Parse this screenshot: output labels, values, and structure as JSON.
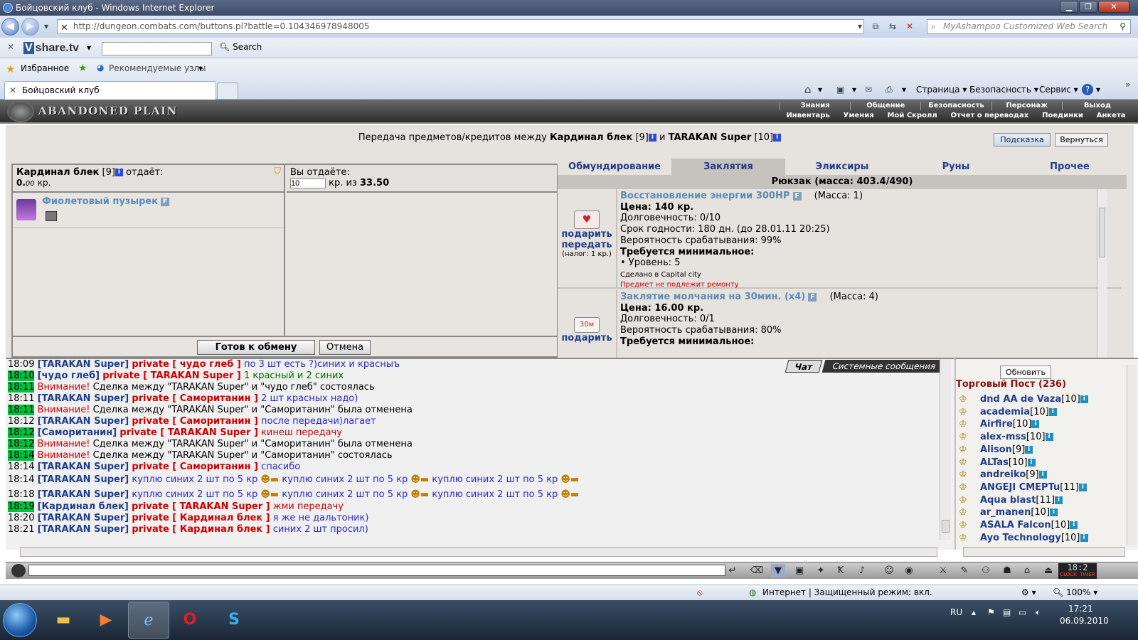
{
  "window": {
    "title": "Бойцовский клуб - Windows Internet Explorer",
    "url": "http://dungeon.combats.com/buttons.pl?battle=0.104346978948005",
    "search_placeholder": "MyAshampoo Customized Web Search"
  },
  "toolbar2": {
    "logo_box": "V",
    "logo": "share.tv",
    "search_label": "Search"
  },
  "favbar": {
    "favorites": "Избранное",
    "suggested": "Рекомендуемые узлы"
  },
  "tab": {
    "title": "Бойцовский клуб"
  },
  "commandbar": {
    "page": "Страница",
    "safety": "Безопасность",
    "tools": "Сервис"
  },
  "game": {
    "logo": "ABANDONED PLAIN",
    "menu_top": [
      "Знания",
      "Общение",
      "Безопасность",
      "Персонаж",
      "Выход"
    ],
    "menu_bottom": [
      "Инвентарь",
      "Умения",
      "Мой Скролл",
      "Отчет о переводах",
      "Поединки",
      "Анкета"
    ]
  },
  "trade": {
    "header_prefix": "Передача предметов/кредитов между",
    "user1": "Кардинал блек",
    "user1_level": "[9]",
    "and": "и",
    "user2": "TARAKAN Super",
    "user2_level": "[10]",
    "hint_btn": "Подсказка",
    "back_btn": "Вернуться",
    "left_title_name": "Кардинал блек",
    "left_title_level": "[9]",
    "left_title_suffix": "отдаёт:",
    "left_amount": "0.",
    "left_amount_dec": "00",
    "left_amount_unit": "кр.",
    "right_title": "Вы отдаёте:",
    "right_input": "10",
    "right_kr": "кр. из",
    "right_total": "33.50",
    "item_name": "Фиолетовый пузырек",
    "ready_btn": "Готов к обмену",
    "cancel_btn": "Отмена"
  },
  "inventory": {
    "tabs": [
      "Обмундирование",
      "Заклятия",
      "Эликсиры",
      "Руны",
      "Прочее"
    ],
    "selected_tab": "Заклятия",
    "bag": "Рюкзак (масса: 403.4/490)",
    "item1": {
      "name": "Восстановление энергии 300HP",
      "mass": "(Масса: 1)",
      "price": "Цена: 140 кр.",
      "durability": "Долговечность: 0/10",
      "expiry": "Срок годности: 180 дн. (до 28.01.11 20:25)",
      "chance": "Вероятность срабатывания: 99%",
      "req": "Требуется минимальное:",
      "level": "• Уровень: 5",
      "made": "Сделано в Capital city",
      "norepair": "Предмет не подлежит ремонту",
      "gift": "подарить",
      "give": "передать",
      "tax": "(налог: 1 кр.)"
    },
    "item2": {
      "name": "Заклятие молчания на 30мин. (x4)",
      "mass": "(Масса: 4)",
      "price": "Цена: 16.00 кр.",
      "durability": "Долговечность: 0/1",
      "chance": "Вероятность срабатывания: 80%",
      "req": "Требуется минимальное:",
      "gift": "подарить"
    }
  },
  "chat": {
    "tabs": [
      "Чат",
      "Системные сообщения"
    ],
    "lines": [
      {
        "t": "18:09",
        "hl": false,
        "a": "[TARAKAN Super]",
        "p": "private [ чудо глеб ]",
        "m": "по 3 шт есть ?)синих и красныъ"
      },
      {
        "t": "18:10",
        "hl": true,
        "a": "[чудо глеб]",
        "p": "private [ TARAKAN Super ]",
        "m": "1 красный и 2 синих"
      },
      {
        "t": "18:11",
        "hl": true,
        "w": "Внимание!",
        "m": "Сделка между \"TARAKAN Super\" и \"чудо глеб\" состоялась"
      },
      {
        "t": "18:11",
        "hl": false,
        "a": "[TARAKAN Super]",
        "p": "private [ Самоританин ]",
        "m": "2 шт красных надо)"
      },
      {
        "t": "18:11",
        "hl": true,
        "w": "Внимание!",
        "m": "Сделка между \"TARAKAN Super\" и \"Самоританин\" была отменена"
      },
      {
        "t": "18:12",
        "hl": false,
        "a": "[TARAKAN Super]",
        "p": "private [ Самоританин ]",
        "m": "после передачи)лагает"
      },
      {
        "t": "18:12",
        "hl": true,
        "a": "[Самоританин]",
        "p": "private [ TARAKAN Super ]",
        "m": "кинеш передачу"
      },
      {
        "t": "18:12",
        "hl": true,
        "w": "Внимание!",
        "m": "Сделка между \"TARAKAN Super\" и \"Самоританин\" была отменена"
      },
      {
        "t": "18:14",
        "hl": true,
        "w": "Внимание!",
        "m": "Сделка между \"TARAKAN Super\" и \"Самоританин\" состоялась"
      },
      {
        "t": "18:14",
        "hl": false,
        "a": "[TARAKAN Super]",
        "p": "private [ Самоританин ]",
        "m": "спасибо"
      },
      {
        "t": "18:14",
        "hl": false,
        "a": "[TARAKAN Super]",
        "m": "куплю синих 2 шт по 5 кр"
      },
      {
        "t": "18:18",
        "hl": false,
        "a": "[TARAKAN Super]",
        "m": "куплю синих 2 шт по 5 кр"
      },
      {
        "t": "18:19",
        "hl": true,
        "a": "[Кардинал блек]",
        "p": "private [ TARAKAN Super ]",
        "m": "жми передачу"
      },
      {
        "t": "18:20",
        "hl": false,
        "a": "[TARAKAN Super]",
        "p": "private [ Кардинал блек ]",
        "m": "я же не дальтоник)"
      },
      {
        "t": "18:21",
        "hl": false,
        "a": "[TARAKAN Super]",
        "p": "private [ Кардинал блек ]",
        "m": "синих 2 шт просил)"
      }
    ]
  },
  "roster": {
    "refresh_btn": "Обновить",
    "title": "Торговый Пост (236)",
    "players": [
      {
        "n": "dnd AA de Vaza",
        "l": "[10]"
      },
      {
        "n": "academia",
        "l": "[10]"
      },
      {
        "n": "Airfire",
        "l": "[10]"
      },
      {
        "n": "alex-mss",
        "l": "[10]"
      },
      {
        "n": "Alison",
        "l": "[9]"
      },
      {
        "n": "ALTas",
        "l": "[10]"
      },
      {
        "n": "andreiko",
        "l": "[9]"
      },
      {
        "n": "ANGEJI CMEPTu",
        "l": "[11]"
      },
      {
        "n": "Aqua blast",
        "l": "[11]"
      },
      {
        "n": "ar_manen",
        "l": "[10]"
      },
      {
        "n": "ASALA Falcon",
        "l": "[10]"
      },
      {
        "n": "Ayo Technology",
        "l": "[10]"
      }
    ]
  },
  "clock": {
    "time": "18:2",
    "label1": "CLOCK",
    "label2": "TIMER"
  },
  "status": {
    "zone": "Интернет | Защищенный режим: вкл.",
    "zoom": "100%"
  },
  "taskbar": {
    "lang": "RU",
    "time": "17:21",
    "date": "06.09.2010"
  }
}
